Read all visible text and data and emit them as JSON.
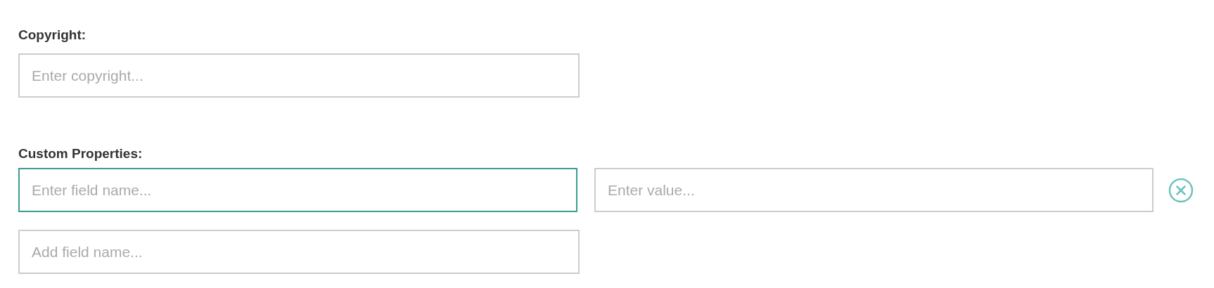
{
  "copyright": {
    "label": "Copyright:",
    "placeholder": "Enter copyright..."
  },
  "custom_properties": {
    "label": "Custom Properties:",
    "rows": [
      {
        "name": {
          "placeholder": "Enter field name...",
          "focused": true
        },
        "value": {
          "placeholder": "Enter value...",
          "focused": false
        }
      }
    ],
    "add_field": {
      "placeholder": "Add field name..."
    }
  }
}
